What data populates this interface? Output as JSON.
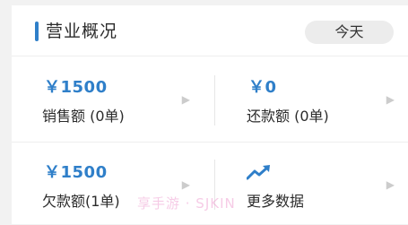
{
  "header": {
    "title": "营业概况",
    "date_filter": "今天"
  },
  "stats": [
    {
      "value": "￥1500",
      "label": "销售额 (0单)"
    },
    {
      "value": "￥0",
      "label": "还款额 (0单)"
    },
    {
      "value": "￥1500",
      "label": "欠款额(1单)"
    },
    {
      "value": "",
      "label": "更多数据"
    }
  ],
  "icons": {
    "more_data": "trending-up-icon",
    "chevron": "chevron-right-icon"
  },
  "watermark": "享手游 · SJKIN",
  "colors": {
    "accent": "#2f7fc9",
    "text": "#2b2b2b",
    "pill_bg": "#ececec"
  }
}
